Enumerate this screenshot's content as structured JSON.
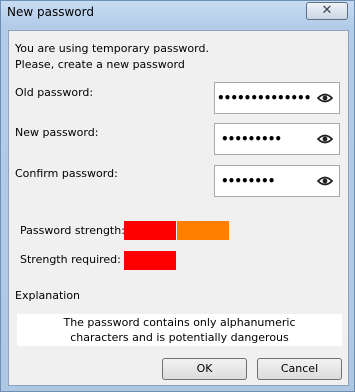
{
  "window": {
    "title": "New password",
    "close_glyph": "✕"
  },
  "intro": {
    "line1": "You are using temporary password.",
    "line2": " Please, create a new password"
  },
  "fields": {
    "old": {
      "label": "Old password:",
      "value": "••••••••••••••"
    },
    "new": {
      "label": "New password:",
      "value": "•••••••••"
    },
    "confirm": {
      "label": "Confirm password:",
      "value": "••••••••"
    }
  },
  "strength": {
    "label": "Password strength:",
    "level_segments": 2,
    "colors": [
      "#ff0000",
      "#ff8000"
    ]
  },
  "required": {
    "label": "Strength required:",
    "level_segments": 1,
    "colors": [
      "#ff0000"
    ]
  },
  "explanation": {
    "heading": "Explanation",
    "line1": "The password contains only alphanumeric",
    "line2": "characters and is potentially dangerous"
  },
  "buttons": {
    "ok": "OK",
    "cancel": "Cancel"
  },
  "icons": {
    "visibility": "eye-icon",
    "close": "close-icon"
  }
}
